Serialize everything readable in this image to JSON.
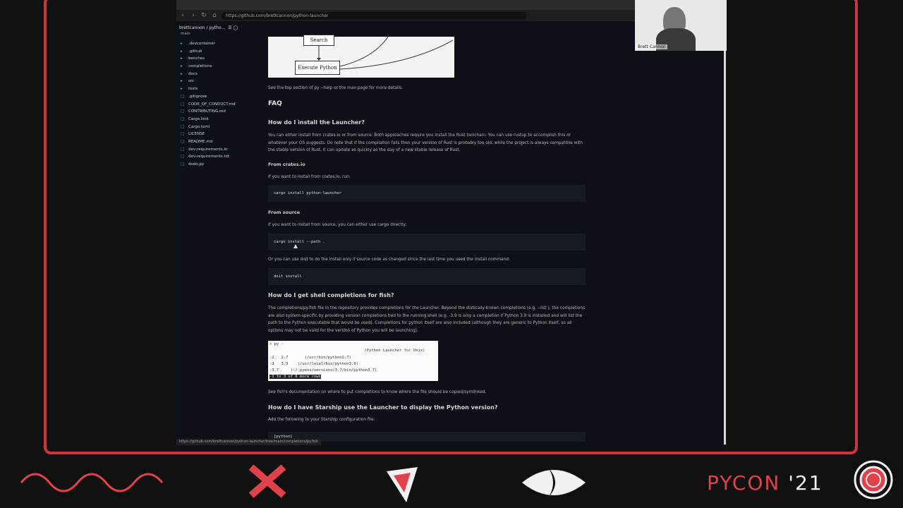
{
  "browser": {
    "url": "https://github.com/brettcannon/python-launcher",
    "status_url": "https://github.com/brettcannon/python-launcher/tree/main/completions/py.fish"
  },
  "sidebar": {
    "repo_name": "brettcannon / pytho...",
    "branch": "main",
    "items": [
      {
        "label": ".devcontainer",
        "icon": "folder-icon"
      },
      {
        "label": ".github",
        "icon": "folder-icon"
      },
      {
        "label": "benches",
        "icon": "folder-icon"
      },
      {
        "label": "completions",
        "icon": "folder-icon"
      },
      {
        "label": "docs",
        "icon": "folder-icon"
      },
      {
        "label": "src",
        "icon": "folder-icon"
      },
      {
        "label": "tests",
        "icon": "folder-icon"
      },
      {
        "label": ".gitignore",
        "icon": "file-icon"
      },
      {
        "label": "CODE_OF_CONDUCT.md",
        "icon": "file-icon"
      },
      {
        "label": "CONTRIBUTING.md",
        "icon": "file-icon"
      },
      {
        "label": "Cargo.lock",
        "icon": "file-icon"
      },
      {
        "label": "Cargo.toml",
        "icon": "file-icon"
      },
      {
        "label": "LICENSE",
        "icon": "file-icon"
      },
      {
        "label": "README.md",
        "icon": "file-icon"
      },
      {
        "label": "dev-requirements.in",
        "icon": "file-icon"
      },
      {
        "label": "dev-requirements.txt",
        "icon": "file-icon"
      },
      {
        "label": "dodo.py",
        "icon": "file-icon"
      }
    ]
  },
  "diagram": {
    "top_box": "Search",
    "bottom_box": "Execute Python"
  },
  "content": {
    "see_top": "See the top section of  py --help  or the man page for more details.",
    "faq": "FAQ",
    "q_install": "How do I install the Launcher?",
    "p_install": "You can either install from crates.io or from source. Both approaches require you install the Rust toolchain. You can use rustup to accomplish this or whatever your OS suggests. Do note that if the compilation fails then your version of Rust is probably too old; while the project is always compatible with the stable version of Rust, it can update as quickly as the day of a new stable release of Rust.",
    "h_crates": "From crates.io",
    "p_crates": "If you want to install from crates.io, run:",
    "code_crates": "cargo install python-launcher",
    "h_source": "From source",
    "p_source": "If you want to install from source, you can either use  cargo  directly:",
    "code_source": "cargo install --path .",
    "p_doit": "Or you can use  doit  to do the install only if source code as changed since the last time you used the  install  command:",
    "code_doit": "doit install",
    "q_fish": "How do I get shell completions for fish?",
    "p_fish": "The  completions/py.fish  file in the repository provides completions for the Launcher. Beyond the statically-known completions (e.g.  --list ), the completions are also system-specific by providing version completions tied to the running shell (e.g.  -3.9  is only a completion if Python 3.9 is installed and will list the path to the Python executable that would be used). Completions for  python  itself are also included (although they are generic to Python itself, so all options may not be valid for the version of Python you will be launching).",
    "p_fish_doc": "See fish's documentation on where to put completions to know where the file should be copied/symlinked.",
    "q_starship": "How do I have Starship use the Launcher to display the Python version?",
    "p_starship": "Add the following to your Starship configuration file:",
    "code_starship": "[python]"
  },
  "terminal": {
    "rows": [
      "> py -",
      "              (Python Launcher for Unix)",
      "-2   2.7       (/usr/bin/python2.7)",
      "-3   3.9    (/usr/local/bin/python3.9)",
      "-3.7     (~/.pyenv/versions/3.7/bin/python3.7)",
      "-1 to 3 of 6 more rows"
    ]
  },
  "webcam": {
    "name": "Brett Cannon"
  },
  "footer": {
    "brand": "PYCON",
    "year": "'21",
    "accent": "#e0424c"
  }
}
